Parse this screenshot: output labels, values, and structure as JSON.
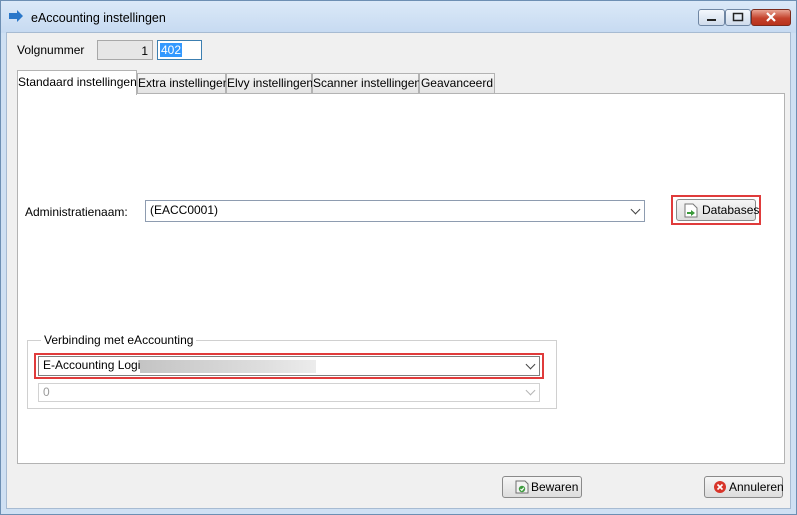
{
  "window": {
    "title": "eAccounting instellingen",
    "controls": {
      "minimize": "minimize",
      "maximize": "maximize",
      "close": "close"
    }
  },
  "header": {
    "volgnummer_label": "Volgnummer",
    "volgnummer_value": "1",
    "volgnummer_next": "402"
  },
  "tabs": [
    {
      "label": "Standaard instellingen",
      "active": true
    },
    {
      "label": "Extra instellingen",
      "active": false
    },
    {
      "label": "Elvy instellingen",
      "active": false
    },
    {
      "label": "Scanner instellingen",
      "active": false
    },
    {
      "label": "Geavanceerd",
      "active": false
    }
  ],
  "standard": {
    "administratie_label": "Administratienaam:",
    "administratie_value": "(EACC0001)",
    "databases_button": "Databases",
    "group_title": "Verbinding met eAccounting",
    "login_value": "E-Accounting Login",
    "secondary_value": "0"
  },
  "footer": {
    "save_button": "Bewaren",
    "cancel_button": "Annuleren"
  },
  "colors": {
    "highlight_border": "#e03b3b",
    "selection": "#3399ff",
    "window_frame": "#cfe0f3"
  },
  "icons": {
    "app": "arrow-app-icon",
    "databases": "database-document-icon",
    "save": "save-icon",
    "cancel": "cancel-icon"
  }
}
